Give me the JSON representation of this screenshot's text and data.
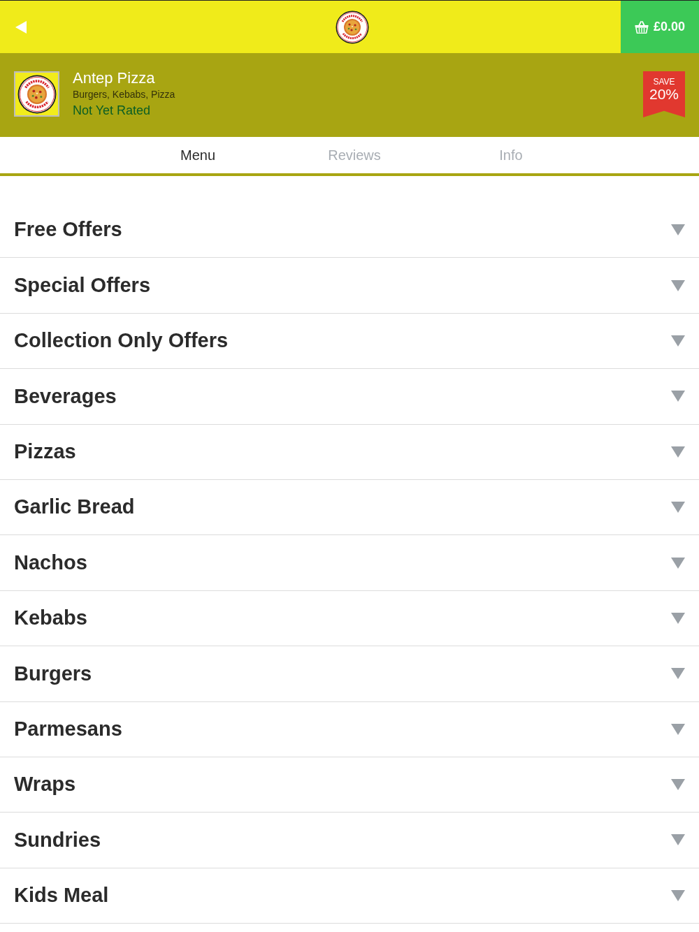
{
  "top_bar": {
    "cart": {
      "total": "£0.00"
    }
  },
  "restaurant": {
    "name": "Antep Pizza",
    "cuisines": "Burgers, Kebabs, Pizza",
    "rating": "Not Yet Rated",
    "badge": {
      "label": "SAVE",
      "value": "20%"
    }
  },
  "tabs": [
    {
      "label": "Menu",
      "selected": true
    },
    {
      "label": "Reviews",
      "selected": false
    },
    {
      "label": "Info",
      "selected": false
    }
  ],
  "categories": [
    {
      "label": "Free Offers",
      "expanded": false
    },
    {
      "label": "Special Offers",
      "expanded": false
    },
    {
      "label": "Collection Only Offers",
      "expanded": false
    },
    {
      "label": "Beverages",
      "expanded": false
    },
    {
      "label": "Pizzas",
      "expanded": false
    },
    {
      "label": "Garlic Bread",
      "expanded": false
    },
    {
      "label": "Nachos",
      "expanded": false
    },
    {
      "label": "Kebabs",
      "expanded": false
    },
    {
      "label": "Burgers",
      "expanded": false
    },
    {
      "label": "Parmesans",
      "expanded": false
    },
    {
      "label": "Wraps",
      "expanded": false
    },
    {
      "label": "Sundries",
      "expanded": false
    },
    {
      "label": "Kids Meal",
      "expanded": false
    }
  ]
}
